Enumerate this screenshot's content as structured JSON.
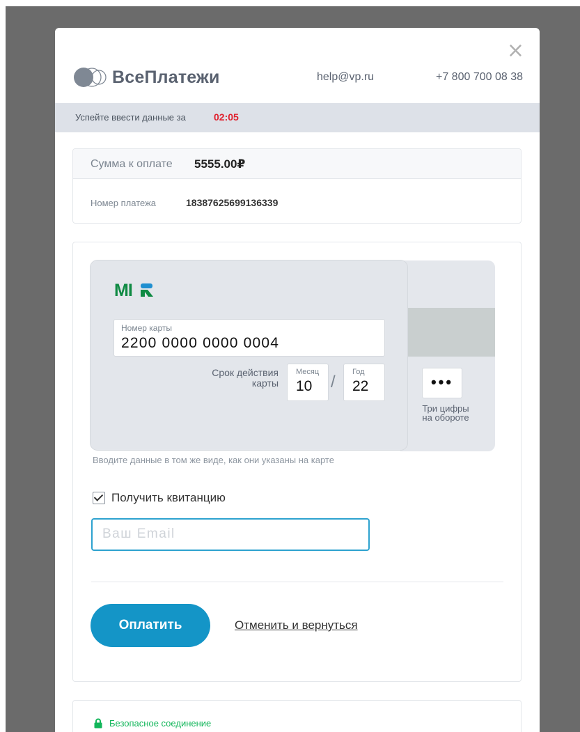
{
  "header": {
    "brand": "ВсеПлатежи",
    "email": "help@vp.ru",
    "phone": "+7 800 700 08 38",
    "close_icon": "close-icon"
  },
  "timer": {
    "label": "Успейте ввести данные за",
    "time": "02:05"
  },
  "payment": {
    "amount_label": "Сумма к оплате",
    "amount_value": "5555.00",
    "currency": "₽",
    "number_label": "Номер платежа",
    "number_value": "18387625699136339"
  },
  "card": {
    "brand_logo": "MIR",
    "number_label": "Номер карты",
    "number_value": "2200 0000 0000 0004",
    "expiry_label": "Срок действия карты",
    "month_label": "Месяц",
    "month_value": "10",
    "year_label": "Год",
    "year_value": "22",
    "cvc_value": "•••",
    "cvc_hint": "Три цифры на обороте",
    "hint": "Вводите данные в том же виде, как они указаны на карте"
  },
  "receipt": {
    "checkbox_label": "Получить квитанцию",
    "checked": true,
    "email_placeholder": "Ваш Email"
  },
  "actions": {
    "pay_label": "Оплатить",
    "cancel_label": "Отменить и вернуться"
  },
  "security": {
    "label": "Безопасное соединение"
  },
  "colors": {
    "accent": "#1495c7",
    "timer": "#e0212e",
    "secure": "#12b65a",
    "mir_green": "#0f8a43",
    "mir_blue": "#1f8fd0"
  }
}
